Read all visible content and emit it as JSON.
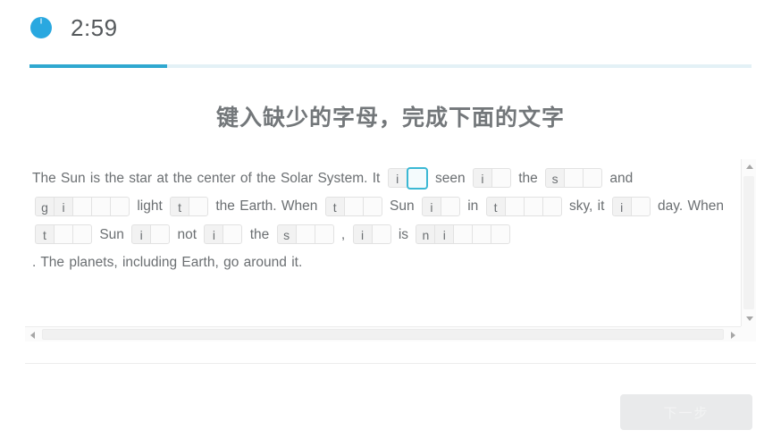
{
  "header": {
    "timer_icon": "clock-icon",
    "timer_value": "2:59",
    "progress_percent": 19,
    "accent_color": "#2fa8d0",
    "track_color": "#e3f1f6"
  },
  "title": "键入缺少的字母，完成下面的文字",
  "exercise": {
    "focus_color": "#3bb8d4",
    "segments": [
      {
        "type": "text",
        "value": "The Sun is the star at the center of the Solar System. It"
      },
      {
        "type": "word",
        "cells": [
          {
            "letter": "i",
            "state": "given"
          },
          {
            "letter": "",
            "state": "focused"
          }
        ]
      },
      {
        "type": "text",
        "value": "seen"
      },
      {
        "type": "word",
        "cells": [
          {
            "letter": "i",
            "state": "given"
          },
          {
            "letter": "",
            "state": "blank"
          }
        ]
      },
      {
        "type": "text",
        "value": "the"
      },
      {
        "type": "word",
        "cells": [
          {
            "letter": "s",
            "state": "given"
          },
          {
            "letter": "",
            "state": "blank"
          },
          {
            "letter": "",
            "state": "blank"
          }
        ]
      },
      {
        "type": "text",
        "value": "and"
      },
      {
        "type": "word",
        "cells": [
          {
            "letter": "g",
            "state": "given"
          },
          {
            "letter": "i",
            "state": "given"
          },
          {
            "letter": "",
            "state": "blank"
          },
          {
            "letter": "",
            "state": "blank"
          },
          {
            "letter": "",
            "state": "blank"
          }
        ]
      },
      {
        "type": "text",
        "value": "light"
      },
      {
        "type": "word",
        "cells": [
          {
            "letter": "t",
            "state": "given"
          },
          {
            "letter": "",
            "state": "blank"
          }
        ]
      },
      {
        "type": "text",
        "value": "the Earth. When"
      },
      {
        "type": "word",
        "cells": [
          {
            "letter": "t",
            "state": "given"
          },
          {
            "letter": "",
            "state": "blank"
          },
          {
            "letter": "",
            "state": "blank"
          }
        ]
      },
      {
        "type": "text",
        "value": "Sun"
      },
      {
        "type": "word",
        "cells": [
          {
            "letter": "i",
            "state": "given"
          },
          {
            "letter": "",
            "state": "blank"
          }
        ]
      },
      {
        "type": "text",
        "value": "in"
      },
      {
        "type": "word",
        "cells": [
          {
            "letter": "t",
            "state": "given"
          },
          {
            "letter": "",
            "state": "blank"
          },
          {
            "letter": "",
            "state": "blank"
          },
          {
            "letter": "",
            "state": "blank"
          }
        ]
      },
      {
        "type": "text",
        "value": "sky, it"
      },
      {
        "type": "word",
        "cells": [
          {
            "letter": "i",
            "state": "given"
          },
          {
            "letter": "",
            "state": "blank"
          }
        ]
      },
      {
        "type": "text",
        "value": "day."
      },
      {
        "type": "text",
        "value": "When"
      },
      {
        "type": "word",
        "cells": [
          {
            "letter": "t",
            "state": "given"
          },
          {
            "letter": "",
            "state": "blank"
          },
          {
            "letter": "",
            "state": "blank"
          }
        ]
      },
      {
        "type": "text",
        "value": "Sun"
      },
      {
        "type": "word",
        "cells": [
          {
            "letter": "i",
            "state": "given"
          },
          {
            "letter": "",
            "state": "blank"
          }
        ]
      },
      {
        "type": "text",
        "value": "not"
      },
      {
        "type": "word",
        "cells": [
          {
            "letter": "i",
            "state": "given"
          },
          {
            "letter": "",
            "state": "blank"
          }
        ]
      },
      {
        "type": "text",
        "value": "the"
      },
      {
        "type": "word",
        "cells": [
          {
            "letter": "s",
            "state": "given"
          },
          {
            "letter": "",
            "state": "blank"
          },
          {
            "letter": "",
            "state": "blank"
          }
        ]
      },
      {
        "type": "text",
        "value": ","
      },
      {
        "type": "word",
        "cells": [
          {
            "letter": "i",
            "state": "given"
          },
          {
            "letter": "",
            "state": "blank"
          }
        ]
      },
      {
        "type": "text",
        "value": "is"
      },
      {
        "type": "word",
        "cells": [
          {
            "letter": "n",
            "state": "given"
          },
          {
            "letter": "i",
            "state": "given"
          },
          {
            "letter": "",
            "state": "blank"
          },
          {
            "letter": "",
            "state": "blank"
          },
          {
            "letter": "",
            "state": "blank"
          }
        ]
      },
      {
        "type": "text",
        "value": ". The planets, including Earth, go around it."
      }
    ]
  },
  "scrollbars": {
    "vertical_up_icon": "arrow-up-icon",
    "vertical_down_icon": "arrow-down-icon",
    "horizontal_left_icon": "arrow-left-icon",
    "horizontal_right_icon": "arrow-right-icon"
  },
  "footer": {
    "next_label": "下一步",
    "next_disabled": true
  }
}
